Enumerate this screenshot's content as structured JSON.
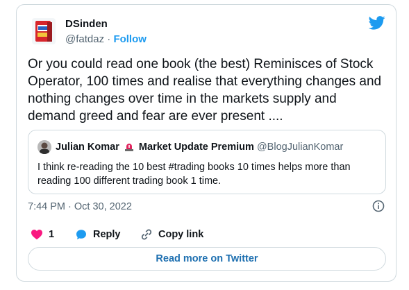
{
  "tweet": {
    "author_name": "DSinden",
    "author_handle": "@fatdaz",
    "separator": " · ",
    "follow_label": "Follow",
    "text": "Or you could read one book (the best) Reminisces of Stock Operator, 100 times and realise that everything changes and nothing changes over time in the markets supply and demand greed and fear are ever present ....",
    "timestamp": "7:44 PM · Oct 30, 2022"
  },
  "quote": {
    "author_name": "Julian Komar",
    "author_name_suffix": "Market Update Premium",
    "author_handle": "@BlogJulianKomar",
    "text": "I think re-reading the 10 best #trading books 10 times helps more than reading 100 different trading book 1 time."
  },
  "actions": {
    "like_count": "1",
    "reply_label": "Reply",
    "copy_link_label": "Copy link"
  },
  "footer": {
    "read_more_label": "Read more on Twitter"
  },
  "colors": {
    "twitter_blue": "#1d9bf0",
    "like_pink": "#f91880",
    "text_primary": "#0f1419",
    "text_secondary": "#536471",
    "border": "#cfd9de"
  },
  "icons": {
    "brand": "twitter-bird-icon",
    "like": "heart-icon",
    "reply": "speech-bubble-icon",
    "copy_link": "link-icon",
    "info": "info-icon",
    "emoji": "siren-icon"
  }
}
